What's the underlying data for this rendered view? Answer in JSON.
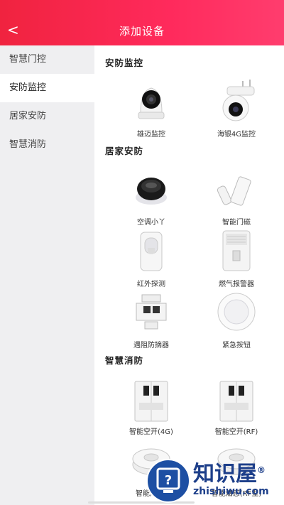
{
  "header": {
    "back_icon": "<",
    "title": "添加设备"
  },
  "sidebar": {
    "items": [
      {
        "label": "智慧门控",
        "active": false
      },
      {
        "label": "安防监控",
        "active": true
      },
      {
        "label": "居家安防",
        "active": false
      },
      {
        "label": "智慧消防",
        "active": false
      }
    ]
  },
  "sections": [
    {
      "title": "安防监控",
      "devices": [
        {
          "label": "雄迈监控",
          "icon": "ptz-camera-icon"
        },
        {
          "label": "海银4G监控",
          "icon": "outdoor-camera-icon"
        }
      ]
    },
    {
      "title": "居家安防",
      "devices": [
        {
          "label": "空调小丫",
          "icon": "ac-controller-icon"
        },
        {
          "label": "智能门磁",
          "icon": "door-sensor-icon"
        },
        {
          "label": "红外探测",
          "icon": "infrared-detector-icon"
        },
        {
          "label": "燃气报警器",
          "icon": "gas-alarm-icon"
        },
        {
          "label": "遇阻防摘器",
          "icon": "anti-removal-icon"
        },
        {
          "label": "紧急按钮",
          "icon": "emergency-button-icon"
        }
      ]
    },
    {
      "title": "智慧消防",
      "devices": [
        {
          "label": "智能空开(4G)",
          "icon": "circuit-breaker-icon"
        },
        {
          "label": "智能空开(RF)",
          "icon": "circuit-breaker-icon"
        },
        {
          "label": "智能烟感(",
          "icon": "smoke-detector-icon"
        },
        {
          "label": "智能烟感(RF型)",
          "icon": "smoke-detector-icon"
        }
      ]
    }
  ],
  "watermark": {
    "brand": "知识屋",
    "registered": "®",
    "domain": "zhishiwu.com"
  }
}
